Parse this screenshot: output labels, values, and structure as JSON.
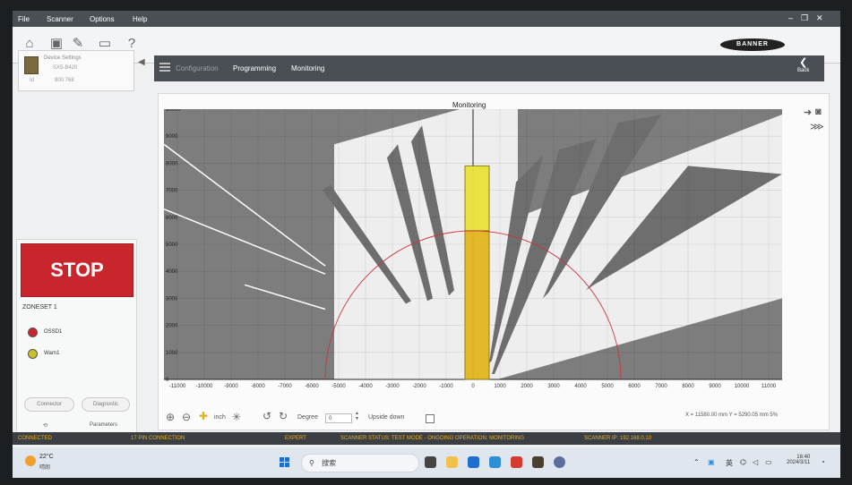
{
  "menu": [
    "File",
    "Scanner",
    "Options",
    "Help"
  ],
  "window_controls": [
    "–",
    "❐",
    "✕"
  ],
  "brand": "BANNER",
  "device": {
    "name": "Device Settings",
    "model": "SX5-B420",
    "id_label": "Id",
    "id": "800 768"
  },
  "nav": {
    "tabs": [
      "Configuration",
      "Programming",
      "Monitoring"
    ],
    "back": "Back"
  },
  "stop_label": "STOP",
  "zoneset": "ZONESET 1",
  "outputs": [
    {
      "label": "OSSD1",
      "color": "#c8262c"
    },
    {
      "label": "Warn1",
      "color": "#c9c030"
    }
  ],
  "left_buttons": [
    "Connector",
    "Diagnostic"
  ],
  "left_tabs": [
    "⟲",
    "Parameters"
  ],
  "monitoring_title": "Monitoring",
  "controls": {
    "unit": "inch",
    "degree_label": "Degree",
    "degree_value": "0",
    "upside_label": "Upside down"
  },
  "coords_text": "X = 11580.00 mm   Y = 5290.05 mm   5%",
  "status": {
    "connected": "CONNECTED",
    "pin": "17 PIN CONNECTION",
    "mode": "EXPERT",
    "scanner_status": "SCANNER STATUS: TEST MODE - ONGOING OPERATION: MONITORING",
    "ip": "SCANNER IP: 192.168.0.10"
  },
  "taskbar": {
    "weather_temp": "22°C",
    "weather_desc": "晴朗",
    "search": "搜索",
    "lang": "英",
    "time": "16:40",
    "date": "2024/3/11"
  },
  "chart_data": {
    "type": "scan",
    "x_ticks": [
      -11000,
      -10000,
      -9000,
      -8000,
      -7000,
      -6000,
      -5000,
      -4000,
      -3000,
      -2000,
      -1000,
      0,
      1000,
      2000,
      3000,
      4000,
      5000,
      6000,
      7000,
      8000,
      9000,
      10000,
      11000
    ],
    "y_ticks": [
      0,
      1000,
      2000,
      3000,
      4000,
      5000,
      6000,
      7000,
      8000,
      9000,
      10000
    ],
    "xlim": [
      -11500,
      11500
    ],
    "ylim": [
      0,
      10000
    ],
    "arc_radius": 5500,
    "arc_color": "#c9363a",
    "zone_color": "#e8d820",
    "grid": true,
    "fields": [
      {
        "name": "protective",
        "x_range": [
          -300,
          600
        ],
        "y_range": [
          0,
          5500
        ],
        "color": "#e3b61f"
      },
      {
        "name": "warning",
        "x_range": [
          -300,
          600
        ],
        "y_range": [
          5500,
          7900
        ],
        "color": "#e8e23a"
      }
    ]
  }
}
